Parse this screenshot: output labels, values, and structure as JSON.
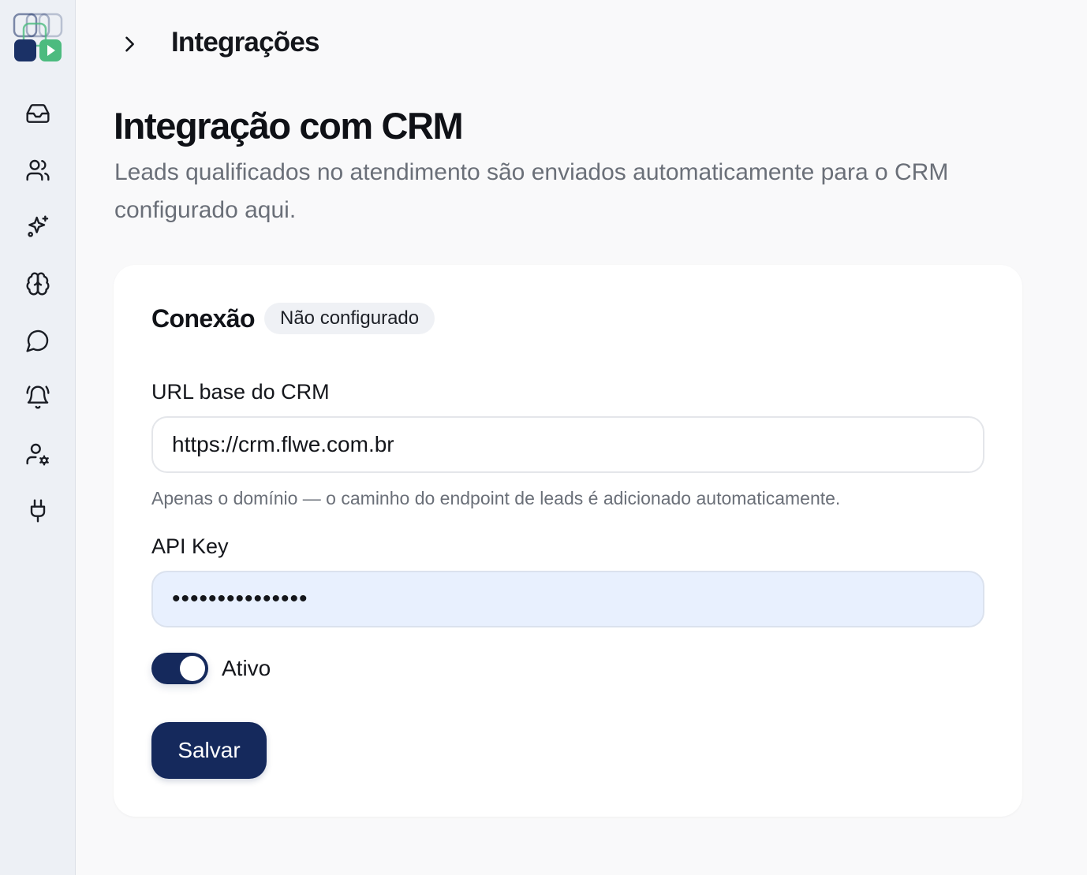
{
  "sidebar": {
    "items": [
      {
        "icon": "inbox-icon",
        "name": "nav-inbox"
      },
      {
        "icon": "users-icon",
        "name": "nav-contacts"
      },
      {
        "icon": "sparkles-icon",
        "name": "nav-ai"
      },
      {
        "icon": "brain-icon",
        "name": "nav-knowledge"
      },
      {
        "icon": "message-circle-icon",
        "name": "nav-conversations"
      },
      {
        "icon": "bell-ring-icon",
        "name": "nav-alerts"
      },
      {
        "icon": "user-cog-icon",
        "name": "nav-user-settings"
      },
      {
        "icon": "plug-icon",
        "name": "nav-integrations"
      }
    ]
  },
  "header": {
    "title": "Integrações"
  },
  "page": {
    "title": "Integração com CRM",
    "description": "Leads qualificados no atendimento são enviados automaticamente para o CRM configurado aqui."
  },
  "card": {
    "title": "Conexão",
    "status_badge": "Não configurado",
    "url_label": "URL base do CRM",
    "url_value": "https://crm.flwe.com.br",
    "url_hint": "Apenas o domínio — o caminho do endpoint de leads é adicionado automaticamente.",
    "api_key_label": "API Key",
    "api_key_value": "•••••••••••••••",
    "active_toggle": {
      "label": "Ativo",
      "on": true
    },
    "save_label": "Salvar"
  },
  "colors": {
    "primary": "#15295c",
    "sidebar_bg": "#edf0f5",
    "page_bg": "#f9f9fa",
    "autofill_bg": "#e8f0fe",
    "logo_navy": "#1b3166",
    "logo_green": "#4cbb7f"
  }
}
